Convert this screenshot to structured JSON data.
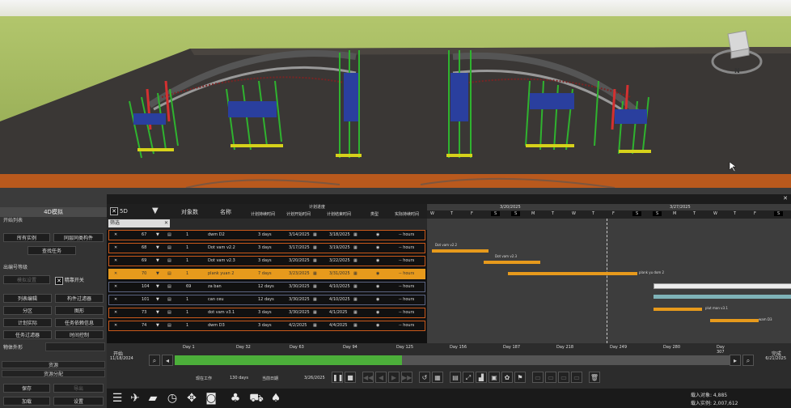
{
  "viewport": {
    "compass_letter": "N"
  },
  "left_panel": {
    "title": "4D模拟",
    "sections": {
      "open_list": "开始列表",
      "all_instances": "所有实例",
      "sync_components": "同层同类构件",
      "find_tasks": "查找任务",
      "appearance": "出编号等级",
      "show_label": "模拟设置",
      "ghost_toggle": "精靠开关"
    },
    "buttons": [
      "列表编辑",
      "构件过滤器",
      "分区",
      "图形",
      "计划实际",
      "任务依赖信息",
      "任务过滤器",
      "时间控制"
    ],
    "appearance_label": "物体外形",
    "resource": "资源",
    "resource_alloc": "资源分配",
    "save": "保存",
    "load": "加载",
    "settings": "设置",
    "export": "导出"
  },
  "schedule": {
    "header_small": "计划进度",
    "top_buttons": [
      "5D",
      "对象数",
      "名称"
    ],
    "columns": [
      "计划持续时间",
      "计划开始时间",
      "计划结束时间",
      "类型",
      "实际持续时间"
    ],
    "filter_label": "筛选",
    "day_letters": [
      "W",
      "T",
      "F",
      "S",
      "S",
      "M",
      "T",
      "W",
      "T",
      "F",
      "S",
      "S",
      "M",
      "T",
      "W",
      "T",
      "F",
      "S"
    ],
    "months": [
      "3/20/2025",
      "3/27/2025"
    ],
    "rows": [
      {
        "id": "67",
        "count": "1",
        "name": "dwm D2",
        "dur": "3 days",
        "start": "3/14/2025",
        "end": "3/18/2025",
        "hours": "-- hours"
      },
      {
        "id": "68",
        "count": "1",
        "name": "Dot vam v2.2",
        "dur": "3 days",
        "start": "3/17/2025",
        "end": "3/19/2025",
        "hours": "-- hours"
      },
      {
        "id": "69",
        "count": "1",
        "name": "Dot vam v2.3",
        "dur": "3 days",
        "start": "3/20/2025",
        "end": "3/22/2025",
        "hours": "-- hours"
      },
      {
        "id": "70",
        "count": "1",
        "name": "plank yuan 2",
        "dur": "7 days",
        "start": "3/23/2025",
        "end": "3/31/2025",
        "hours": "-- hours"
      },
      {
        "id": "104",
        "count": "69",
        "name": "za ban",
        "dur": "12 days",
        "start": "3/30/2025",
        "end": "4/10/2025",
        "hours": "-- hours"
      },
      {
        "id": "101",
        "count": "1",
        "name": "can ceu",
        "dur": "12 days",
        "start": "3/30/2025",
        "end": "4/10/2025",
        "hours": "-- hours"
      },
      {
        "id": "73",
        "count": "1",
        "name": "dot vam v3.1",
        "dur": "3 days",
        "start": "3/30/2025",
        "end": "4/1/2025",
        "hours": "-- hours"
      },
      {
        "id": "74",
        "count": "1",
        "name": "dwm D3",
        "dur": "3 days",
        "start": "4/2/2025",
        "end": "4/4/2025",
        "hours": "-- hours"
      }
    ],
    "gantt_labels": [
      "Dot vam v2.2",
      "Dot vam v2.3",
      "plank yu dom 2",
      "plut man v3.1",
      "wam D3"
    ]
  },
  "timeline": {
    "start_label": "开始",
    "start_date": "11/18/2024",
    "end_label": "完成",
    "end_date": "6/21/2025",
    "days": [
      "Day 1",
      "Day 32",
      "Day 63",
      "Day 94",
      "Day 125",
      "Day 156",
      "Day 187",
      "Day 218",
      "Day 249",
      "Day 280",
      "Day 307"
    ],
    "status_work": "现在工作",
    "status_days": "130 days",
    "status_date_label": "当前日期",
    "status_date": "3/26/2025",
    "progress": 0.41
  },
  "status": {
    "loaded": "载入对象: 4,885",
    "loaded_total": "载入实例: 2,007,612"
  }
}
